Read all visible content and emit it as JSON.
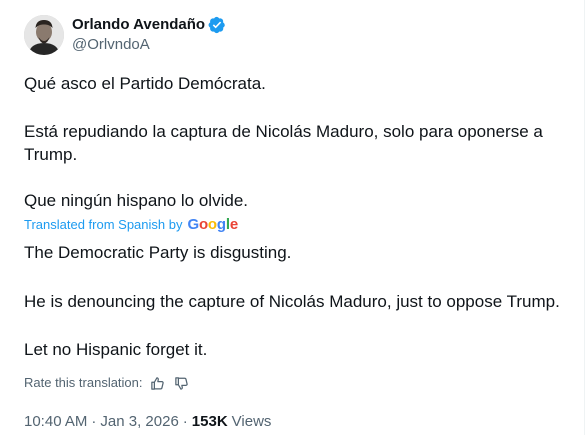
{
  "author": {
    "display_name": "Orlando Avendaño",
    "handle": "@OrlvndoA",
    "verified": true,
    "verified_color": "#1d9bf0"
  },
  "original_text": [
    "Qué asco el Partido Demócrata.",
    "Está repudiando la captura de Nicolás Maduro, solo para oponerse a",
    "Trump.",
    "Que ningún hispano lo olvide."
  ],
  "translation": {
    "label": "Translated from Spanish by",
    "provider": "Google",
    "lines": [
      "The Democratic Party is disgusting.",
      "He is denouncing the capture of Nicolás Maduro, just to oppose Trump.",
      "Let no Hispanic forget it."
    ],
    "rate_label": "Rate this translation:"
  },
  "meta": {
    "time": "10:40 AM",
    "separator": "·",
    "date": "Jan 3, 2026",
    "views_count": "153K",
    "views_label": "Views"
  },
  "icons": {
    "verified": "verified-badge-icon",
    "thumbs_up": "thumbs-up-icon",
    "thumbs_down": "thumbs-down-icon"
  },
  "colors": {
    "text": "#0f1419",
    "secondary": "#536471",
    "link": "#1d9bf0"
  }
}
